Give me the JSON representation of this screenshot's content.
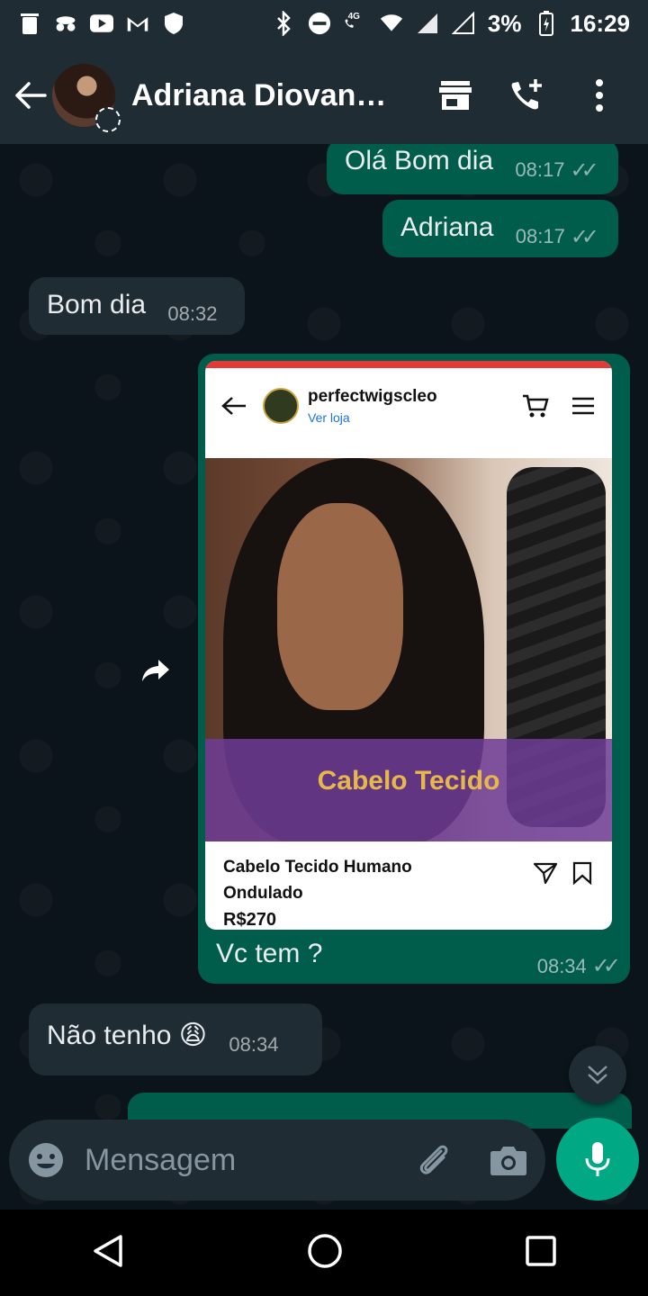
{
  "status_bar": {
    "battery": "3%",
    "time": "16:29",
    "network": "4G"
  },
  "header": {
    "contact_name": "Adriana Diovana…",
    "icons": [
      "back-arrow-icon",
      "store-icon",
      "add-call-icon",
      "more-vert-icon"
    ]
  },
  "messages": [
    {
      "direction": "out",
      "text": "Olá Bom dia",
      "time": "08:17"
    },
    {
      "direction": "out",
      "text": "Adriana",
      "time": "08:17"
    },
    {
      "direction": "in",
      "text": "Bom dia",
      "time": "08:32"
    },
    {
      "direction": "out",
      "type": "image",
      "caption": "Vc tem ?",
      "time": "08:34",
      "screenshot": {
        "store_name": "perfectwigscleo",
        "store_link": "Ver loja",
        "banner_text": "Cabelo Tecido",
        "product_title": "Cabelo Tecido Humano Ondulado",
        "price": "R$270"
      }
    },
    {
      "direction": "in",
      "text": "Não tenho 😩",
      "time": "08:34"
    }
  ],
  "composer": {
    "placeholder": "Mensagem"
  },
  "colors": {
    "header_bg": "#1f2c34",
    "chat_bg": "#0b141a",
    "outgoing_bubble": "#005c4b",
    "incoming_bubble": "#1f2c34",
    "accent": "#00a884"
  }
}
